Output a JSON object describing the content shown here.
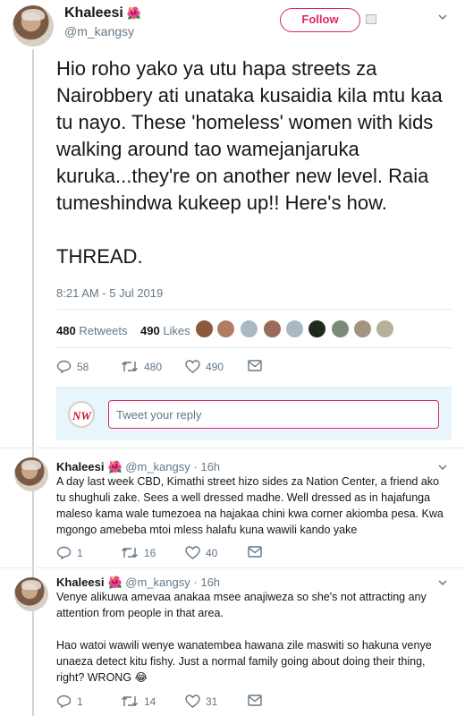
{
  "main_tweet": {
    "display_name": "Khaleesi",
    "handle": "@m_kangsy",
    "follow_label": "Follow",
    "text": "Hio roho yako ya utu hapa streets za Nairobbery ati unataka kusaidia kila mtu kaa tu nayo. These 'homeless' women with kids walking around tao wamejanjaruka kuruka...they're on another new level. Raia tumeshindwa kukeep up!! Here's how.\n\nTHREAD.",
    "timestamp": "8:21 AM - 5 Jul 2019",
    "retweets_count": "480",
    "retweets_label": "Retweets",
    "likes_count": "490",
    "likes_label": "Likes",
    "actions": {
      "replies": "58",
      "retweets": "480",
      "likes": "490"
    }
  },
  "reply_composer": {
    "logo_text": "NW",
    "placeholder": "Tweet your reply"
  },
  "replies": [
    {
      "display_name": "Khaleesi",
      "handle": "@m_kangsy",
      "time": "16h",
      "text": "A day last week CBD, Kimathi street hizo sides za Nation Center, a friend ako tu shughuli zake. Sees a well dressed madhe. Well dressed as in hajafunga maleso kama wale tumezoea na hajakaa chini kwa corner akiomba pesa. Kwa mgongo amebeba mtoi mless halafu kuna wawili kando yake",
      "actions": {
        "replies": "1",
        "retweets": "16",
        "likes": "40"
      }
    },
    {
      "display_name": "Khaleesi",
      "handle": "@m_kangsy",
      "time": "16h",
      "text": "Venye alikuwa amevaa anakaa msee anajiweza so she's not attracting any attention from people in that area.\n\nHao watoi wawili wenye wanatembea hawana zile maswiti so hakuna venye unaeza detect kitu fishy. Just a normal family going about doing their thing, right? WRONG 😂",
      "actions": {
        "replies": "1",
        "retweets": "14",
        "likes": "31"
      }
    }
  ],
  "colors": {
    "follow": "#e0245e",
    "secondary_text": "#657786",
    "divider": "#e6ecf0",
    "composer_bg": "#e8f5fd"
  },
  "icons": [
    "flower-emoji",
    "caret-down-icon",
    "reply-icon",
    "retweet-icon",
    "heart-icon",
    "dm-envelope-icon",
    "avatar"
  ]
}
